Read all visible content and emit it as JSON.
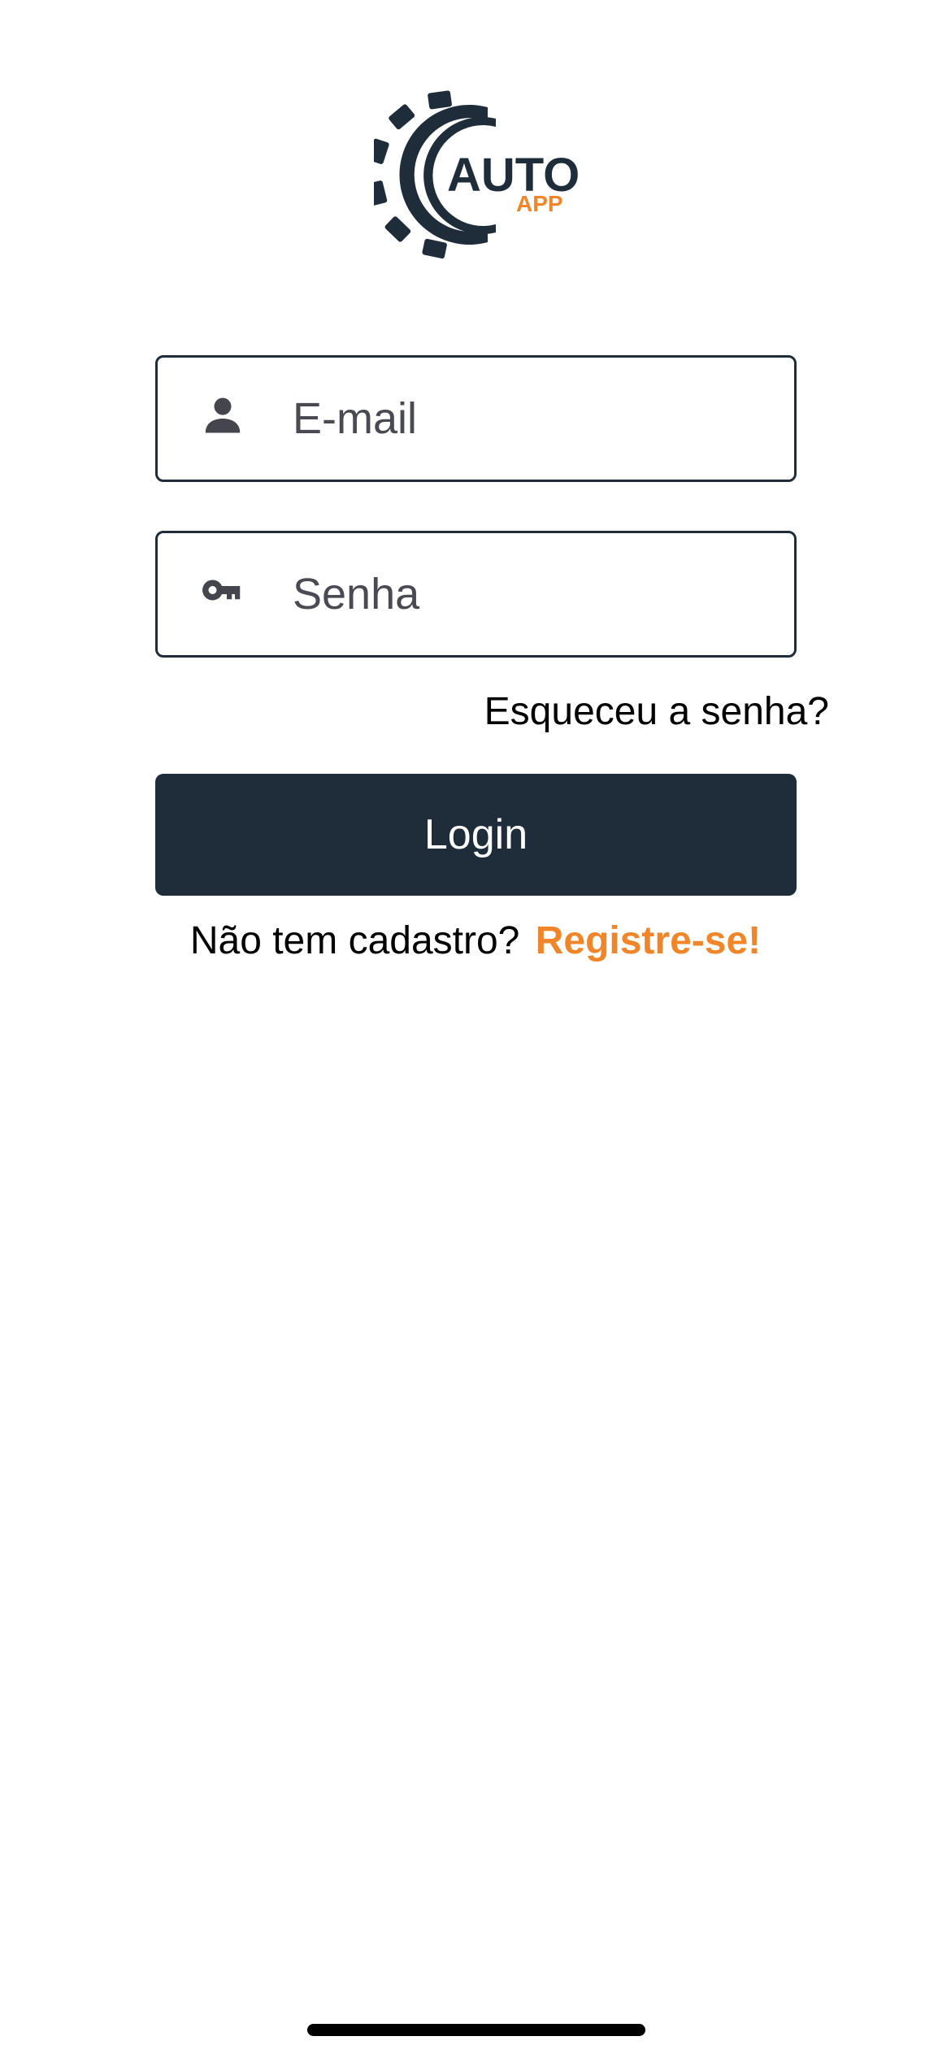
{
  "logo": {
    "title": "AUTO",
    "subtitle": "APP",
    "colors": {
      "primary": "#1f2d3a",
      "accent": "#f0852a"
    }
  },
  "login_form": {
    "email": {
      "placeholder": "E-mail",
      "value": "",
      "icon": "person-icon"
    },
    "password": {
      "placeholder": "Senha",
      "value": "",
      "icon": "key-icon"
    },
    "forgot_password_label": "Esqueceu a senha?",
    "login_button_label": "Login"
  },
  "register": {
    "prompt": "Não tem cadastro?",
    "link_label": "Registre-se!"
  },
  "colors": {
    "primary": "#1f2d3a",
    "accent": "#f0852a",
    "text": "#000000",
    "placeholder": "#4a4a52"
  }
}
